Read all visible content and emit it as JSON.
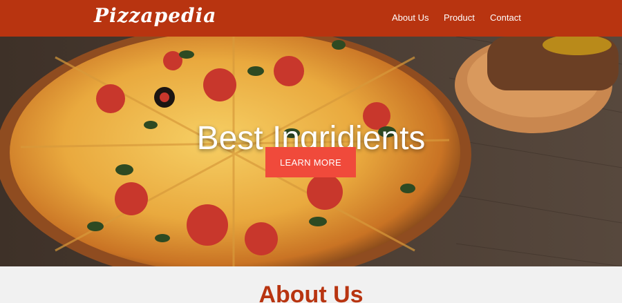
{
  "brand": {
    "logo_text": "Pizzapedia"
  },
  "nav": {
    "items": [
      {
        "label": "About Us"
      },
      {
        "label": "Product"
      },
      {
        "label": "Contact"
      }
    ]
  },
  "hero": {
    "title": "Best Ingridients",
    "cta_label": "LEARN MORE"
  },
  "about": {
    "title": "About Us"
  },
  "colors": {
    "navbar": "#b83410",
    "cta": "#f04a3b",
    "about_title": "#b83410"
  }
}
